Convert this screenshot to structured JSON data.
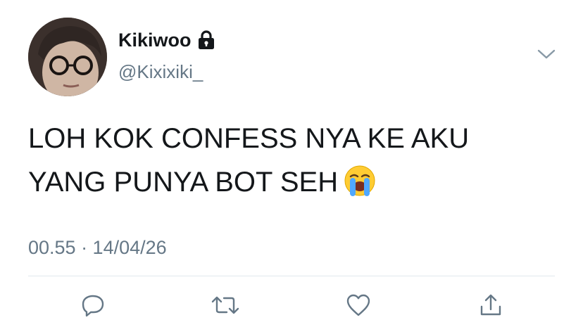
{
  "author": {
    "display_name": "Kikiwoo",
    "handle": "@Kixixiki_",
    "verified_icon": "lock-icon",
    "avatar": "profile-photo"
  },
  "tweet": {
    "lines": [
      "LOH KOK CONFESS NYA KE AKU",
      "YANG PUNYA BOT SEH"
    ],
    "emoji": "loudly-crying-face",
    "timestamp": "00.55 · 14/04/26"
  },
  "actions": [
    {
      "name": "reply",
      "icon": "reply-icon"
    },
    {
      "name": "retweet",
      "icon": "retweet-icon"
    },
    {
      "name": "like",
      "icon": "heart-icon"
    },
    {
      "name": "share",
      "icon": "share-icon"
    }
  ],
  "colors": {
    "text_primary": "#14171a",
    "text_secondary": "#657786",
    "divider": "#e1e8ed",
    "icon": "#657786"
  }
}
